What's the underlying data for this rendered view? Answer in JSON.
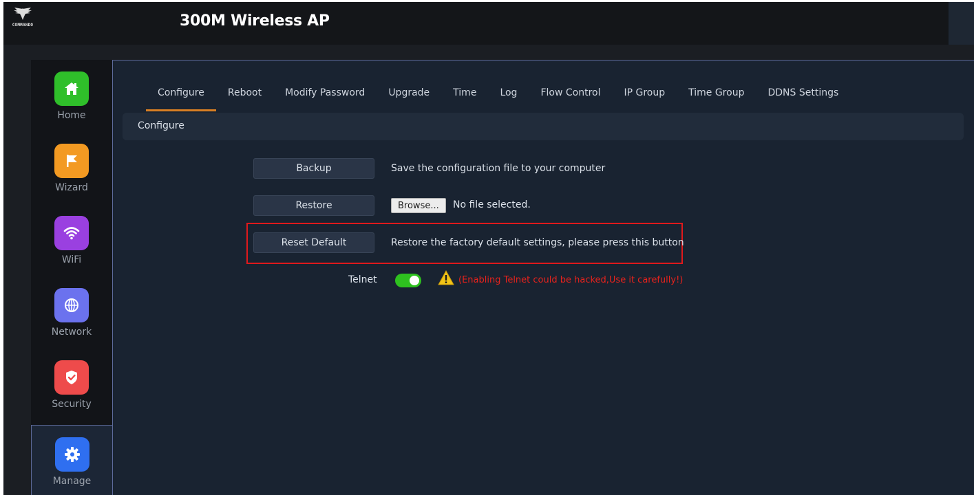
{
  "header": {
    "logo_text": "COMMANDO",
    "title": "300M Wireless AP"
  },
  "sidebar": {
    "items": [
      {
        "label": "Home",
        "icon": "home-icon",
        "color": "#2fbf2a"
      },
      {
        "label": "Wizard",
        "icon": "flag-icon",
        "color": "#f39a22"
      },
      {
        "label": "WiFi",
        "icon": "wifi-icon",
        "color": "#9a40e0"
      },
      {
        "label": "Network",
        "icon": "globe-icon",
        "color": "#6b72ee"
      },
      {
        "label": "Security",
        "icon": "shield-icon",
        "color": "#ee4b4b"
      },
      {
        "label": "Manage",
        "icon": "gear-icon",
        "color": "#2f6ff0",
        "active": true
      }
    ]
  },
  "tabs": [
    {
      "label": "Configure",
      "active": true
    },
    {
      "label": "Reboot"
    },
    {
      "label": "Modify Password"
    },
    {
      "label": "Upgrade"
    },
    {
      "label": "Time"
    },
    {
      "label": "Log"
    },
    {
      "label": "Flow Control"
    },
    {
      "label": "IP Group"
    },
    {
      "label": "Time Group"
    },
    {
      "label": "DDNS Settings"
    }
  ],
  "section": {
    "title": "Configure"
  },
  "actions": {
    "backup": {
      "label": "Backup",
      "description": "Save the configuration file to your computer"
    },
    "restore": {
      "label": "Restore",
      "browse_label": "Browse...",
      "file_status": "No file selected."
    },
    "reset": {
      "label": "Reset Default",
      "description": "Restore the factory default settings, please press this button"
    }
  },
  "telnet": {
    "label": "Telnet",
    "enabled": true,
    "warning": "(Enabling Telnet could be hacked,Use it carefully!)"
  },
  "colors": {
    "accent_tab": "#d97f23",
    "toggle_on": "#2ec11f",
    "warning_text": "#e8221c",
    "highlight_border": "#e0191c"
  }
}
